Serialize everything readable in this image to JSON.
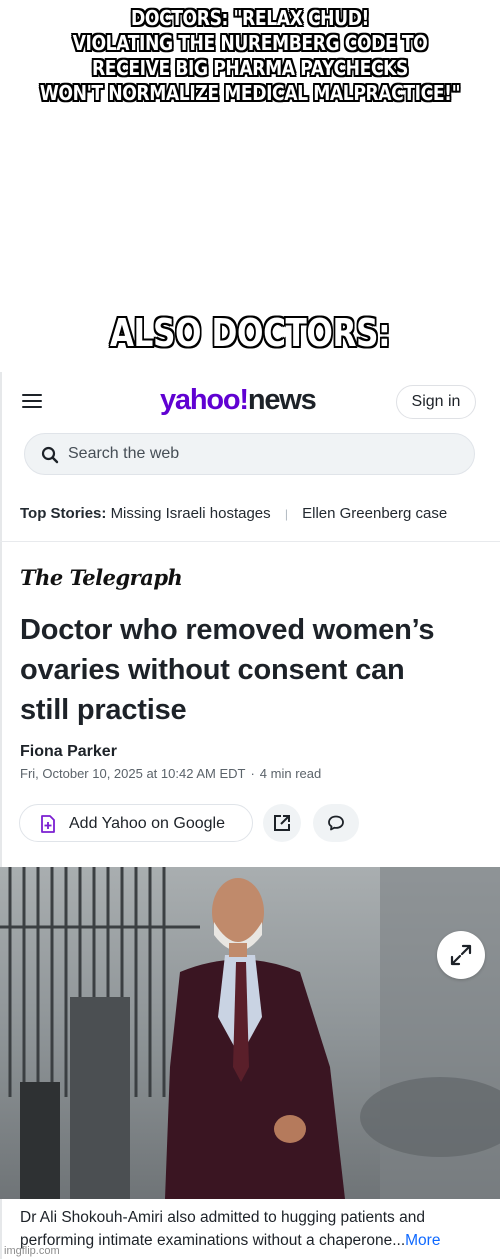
{
  "meme": {
    "top_caption_lines": [
      "DOCTORS: \"RELAX CHUD!",
      "VIOLATING THE NUREMBERG CODE TO",
      "RECEIVE BIG PHARMA PAYCHECKS",
      "WON'T NORMALIZE MEDICAL MALPRACTICE!\""
    ],
    "middle_caption": "ALSO DOCTORS:",
    "watermark": "imgflip.com"
  },
  "header": {
    "logo_yahoo": "yahoo!",
    "logo_news": "news",
    "sign_in_label": "Sign in",
    "logo_color": "#6001d2"
  },
  "search": {
    "placeholder": "Search the web"
  },
  "top_stories": {
    "label": "Top Stories:",
    "items": [
      "Missing Israeli hostages",
      "Ellen Greenberg case"
    ]
  },
  "article": {
    "publisher": "The Telegraph",
    "headline_lines": [
      "Doctor who removed women’s",
      "ovaries without consent can",
      "still practise"
    ],
    "author": "Fiona Parker",
    "date": "Fri, October 10, 2025 at 10:42 AM EDT",
    "read_time": "4 min read",
    "add_google_label": "Add Yahoo on Google",
    "photo_caption_lines": [
      "Dr Ali Shokouh-Amiri also admitted to hugging patients and",
      "performing intimate examinations without a chaperone..."
    ],
    "more_label": "More",
    "link_color": "#0f69ff"
  }
}
